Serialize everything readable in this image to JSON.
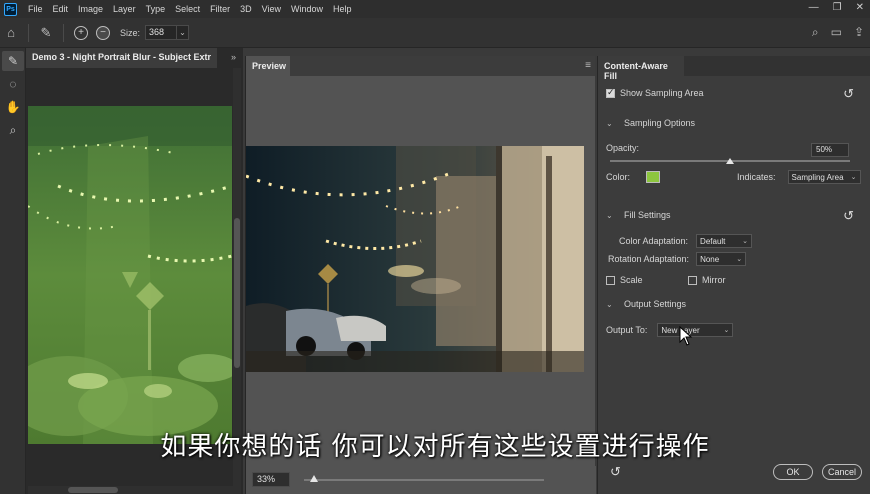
{
  "app": {
    "logo": "Ps",
    "menu": [
      "File",
      "Edit",
      "Image",
      "Layer",
      "Type",
      "Select",
      "Filter",
      "3D",
      "View",
      "Window",
      "Help"
    ]
  },
  "options_bar": {
    "size_label": "Size:",
    "size_value": "368"
  },
  "document": {
    "tab_title": "Demo 3 - Night Portrait Blur - Subject Extr",
    "collapse_glyph": "»"
  },
  "preview": {
    "tab_label": "Preview",
    "zoom_value": "33%",
    "zoom_fraction": 0.33
  },
  "fill_panel": {
    "tab_label": "Content-Aware Fill",
    "show_sampling_area": {
      "label": "Show Sampling Area",
      "checked": true
    },
    "sampling_options": {
      "heading": "Sampling Options",
      "opacity_label": "Opacity:",
      "opacity_value": "50%",
      "opacity_fraction": 0.5,
      "color_label": "Color:",
      "color_value": "#8dc63f",
      "indicates_label": "Indicates:",
      "indicates_value": "Sampling Area"
    },
    "fill_settings": {
      "heading": "Fill Settings",
      "color_adaptation_label": "Color Adaptation:",
      "color_adaptation_value": "Default",
      "rotation_adaptation_label": "Rotation Adaptation:",
      "rotation_adaptation_value": "None",
      "scale_label": "Scale",
      "scale_checked": false,
      "mirror_label": "Mirror",
      "mirror_checked": false
    },
    "output_settings": {
      "heading": "Output Settings",
      "output_to_label": "Output To:",
      "output_to_value": "New Layer"
    },
    "ok_label": "OK",
    "cancel_label": "Cancel"
  },
  "subtitle": "如果你想的话 你可以对所有这些设置进行操作",
  "colors": {
    "sampling_overlay": "#8dc63f",
    "ui_dark": "#323232",
    "ui_panel": "#3c3c3c",
    "preview_bg": "#535353"
  }
}
